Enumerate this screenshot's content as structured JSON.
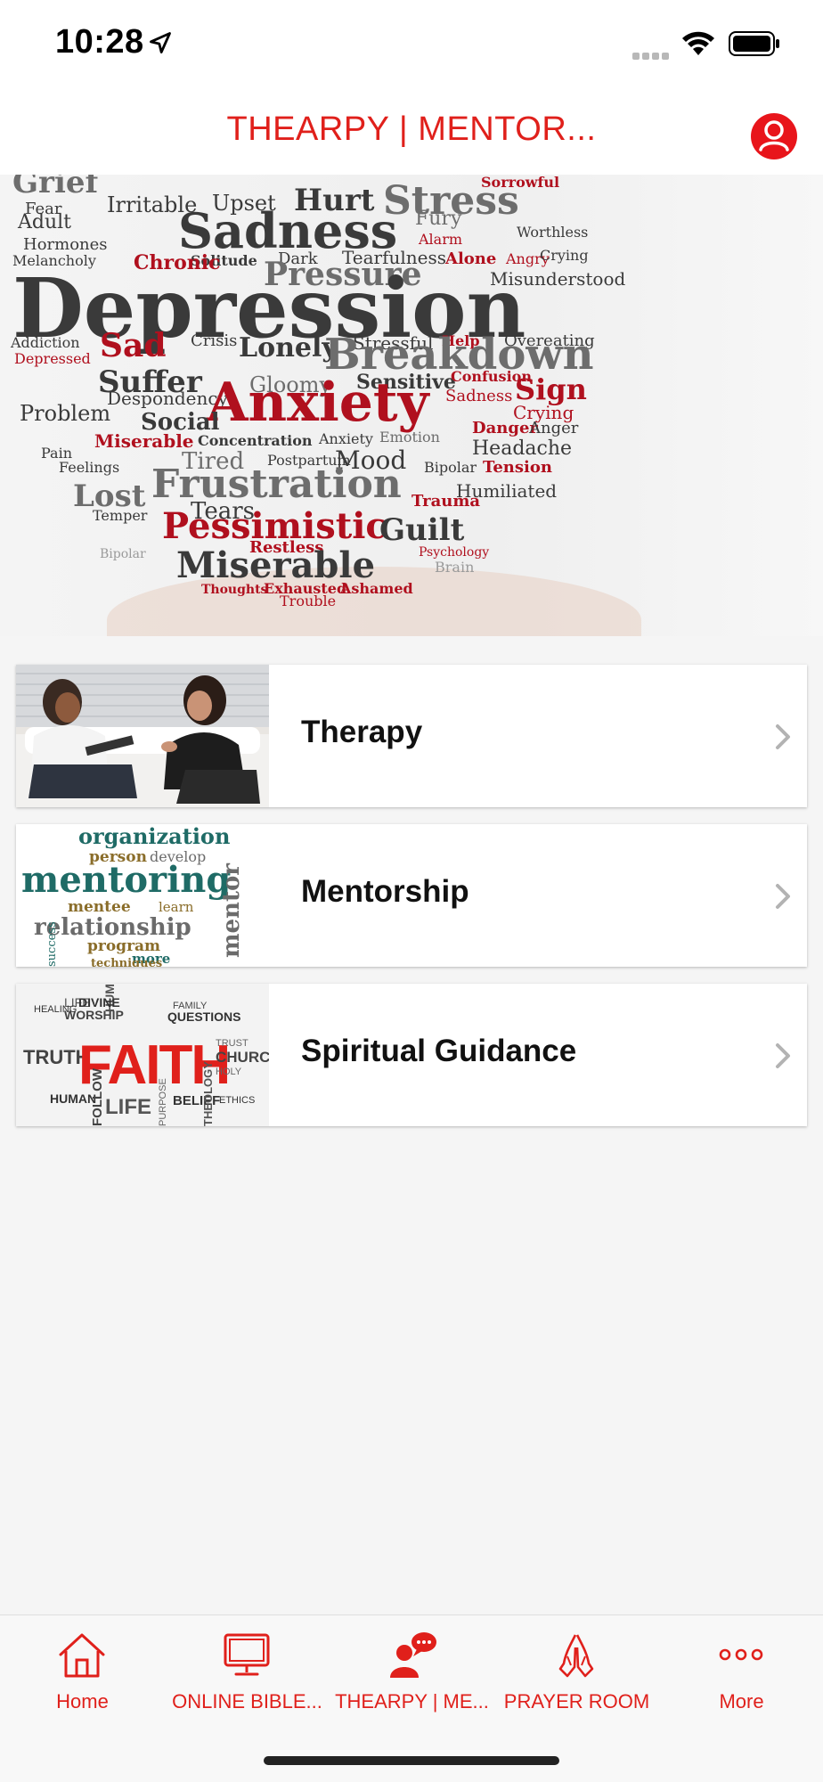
{
  "status": {
    "time": "10:28"
  },
  "header": {
    "title": "THEARPY | MENTOR...",
    "profile_icon": "user-profile-icon"
  },
  "hero": {
    "words": [
      "Grief",
      "Irritable",
      "Fear",
      "Upset",
      "Hurt",
      "Stress",
      "Sorrowful",
      "Adult",
      "Sadness",
      "Fury",
      "Hormones",
      "Melancholy",
      "Solitude",
      "Dark",
      "Tearfulness",
      "Alarm",
      "Worthless",
      "Chronic",
      "Pressure",
      "Alone",
      "Angry",
      "Crying",
      "Depression",
      "Misunderstood",
      "Addiction",
      "Crisis",
      "Stressful",
      "Help",
      "Overeating",
      "Sad",
      "Lonely",
      "Breakdown",
      "Depressed",
      "Suffer",
      "Gloomy",
      "Sensitive",
      "Confusion",
      "Sign",
      "Despondency",
      "Sadness",
      "Crying",
      "Anxiety",
      "Problem",
      "Social",
      "Danger",
      "Anger",
      "Pain",
      "Miserable",
      "Concentration",
      "Anxiety",
      "Emotion",
      "Headache",
      "Feelings",
      "Tired",
      "Postpartum",
      "Mood",
      "Bipolar",
      "Tension",
      "Frustration",
      "Lost",
      "Tears",
      "Trauma",
      "Humiliated",
      "Temper",
      "Pessimistic",
      "Guilt",
      "Bipolar",
      "Restless",
      "Psychology",
      "Miserable",
      "Brain",
      "Thoughts",
      "Exhausted",
      "Ashamed",
      "Trouble"
    ]
  },
  "services": [
    {
      "label": "Therapy",
      "thumb": "therapy-session-image"
    },
    {
      "label": "Mentorship",
      "thumb": "mentoring-wordcloud-image",
      "words": [
        "organization",
        "person",
        "develop",
        "mentoring",
        "mentee",
        "learn",
        "relationship",
        "program",
        "more",
        "mentor",
        "success",
        "techniques"
      ]
    },
    {
      "label": "Spiritual Guidance",
      "thumb": "faith-wordcloud-image",
      "words": [
        "HUMAN",
        "LIFE",
        "DIVINE",
        "HEALING",
        "WORSHIP",
        "FAMILY",
        "QUESTIONS",
        "TRUTH",
        "FAITH",
        "CHURCH",
        "HOLY",
        "TRUST",
        "HUMAN",
        "LIFE",
        "BELIEF",
        "ETHICS",
        "FOLLOW",
        "PURPOSE",
        "THEOLOGY"
      ]
    }
  ],
  "tabs": [
    {
      "label": "Home",
      "icon": "home-icon"
    },
    {
      "label": "ONLINE BIBLE...",
      "icon": "monitor-icon"
    },
    {
      "label": "THEARPY | ME...",
      "icon": "counseling-icon"
    },
    {
      "label": "PRAYER ROOM",
      "icon": "praying-hands-icon"
    },
    {
      "label": "More",
      "icon": "more-dots-icon"
    }
  ],
  "colors": {
    "accent": "#e0201b",
    "background": "#f5f5f5"
  }
}
